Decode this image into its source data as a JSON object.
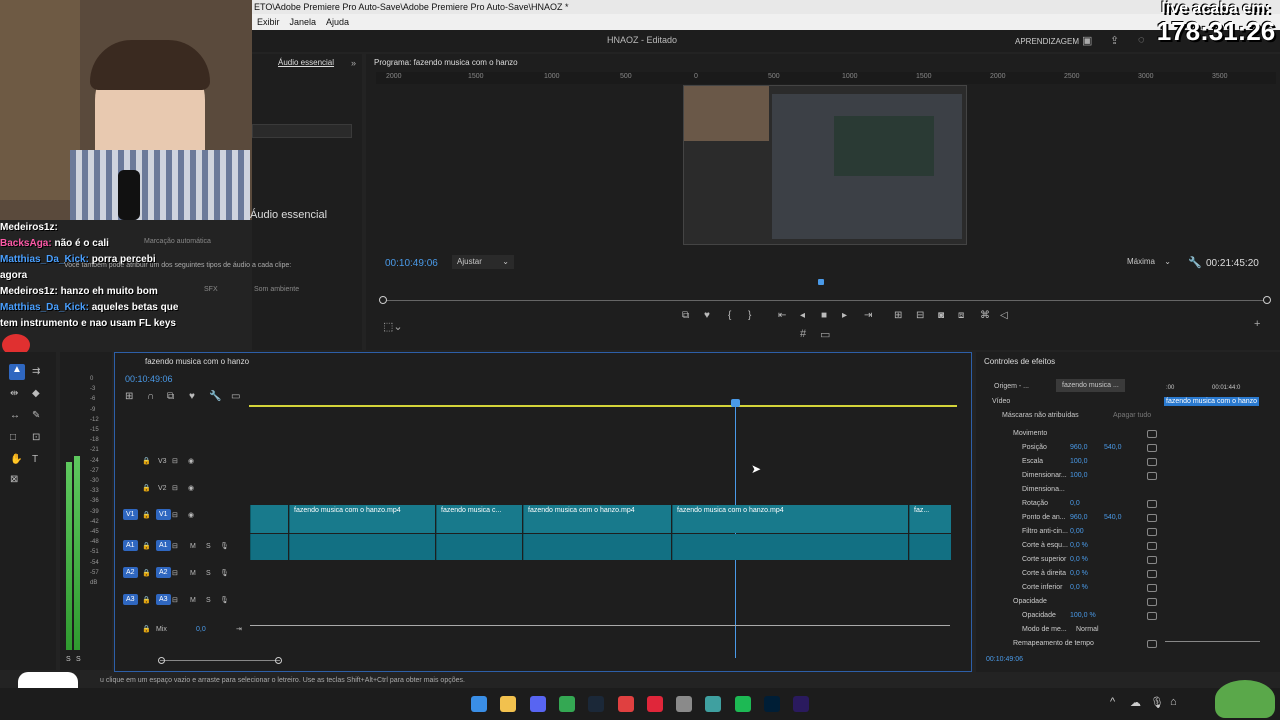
{
  "window": {
    "path": "ETO\\Adobe Premiere Pro Auto-Save\\Adobe Premiere Pro Auto-Save\\HNAOZ *",
    "title": "HNAOZ - Editado",
    "workspace": "APRENDIZAGEM"
  },
  "menu": [
    "Exibir",
    "Janela",
    "Ajuda"
  ],
  "overlay": {
    "live_line1": "live acaba em:",
    "live_timer": "178:31:26"
  },
  "chat": [
    {
      "user": "Medeiros1z:",
      "msg": "",
      "color": "#ffffff"
    },
    {
      "user": "BacksAga:",
      "msg": "não é o cali",
      "color": "#ff5aa8"
    },
    {
      "user": "Matthias_Da_Kick:",
      "msg": "porra percebi",
      "color": "#4aa0ff"
    },
    {
      "user": "agora",
      "msg": "",
      "color": "#ffffff"
    },
    {
      "user": "Medeiros1z:",
      "msg": "hanzo eh muito bom",
      "color": "#ffffff"
    },
    {
      "user": "Matthias_Da_Kick:",
      "msg": "aqueles betas que",
      "color": "#4aa0ff"
    },
    {
      "user": "tem instrumento e nao usam FL keys",
      "msg": "",
      "color": "#ffffff"
    }
  ],
  "essential_audio": {
    "tab": "Áudio essencial",
    "heading": "Áudio essencial",
    "auto": "Marcação automática",
    "hint": "Você também pode atribuir um dos seguintes tipos de áudio a cada clipe:",
    "sfx": "SFX",
    "ambience": "Som ambiente"
  },
  "program": {
    "title": "Programa: fazendo musica com o hanzo",
    "timecode": "00:10:49:06",
    "fit": "Ajustar",
    "quality": "Máxima",
    "duration": "00:21:45:20",
    "ruler": [
      "2000",
      "1500",
      "1000",
      "500",
      "0",
      "500",
      "1000",
      "1500",
      "2000",
      "2500",
      "3000",
      "3500"
    ]
  },
  "timeline": {
    "title": "fazendo musica com o hanzo",
    "timecode": "00:10:49:06",
    "tracks": [
      {
        "name": "V3"
      },
      {
        "name": "V2"
      },
      {
        "name": "V1",
        "src": "V1"
      },
      {
        "name": "A1",
        "src": "A1",
        "m": "M",
        "s": "S"
      },
      {
        "name": "A2",
        "m": "M",
        "s": "S"
      },
      {
        "name": "A3",
        "m": "M",
        "s": "S"
      }
    ],
    "mix_label": "Mix",
    "mix_value": "0,0",
    "clips": [
      "fazendo musica com o hanzo.mp4",
      "fazendo musica c...",
      "fazendo musica com o hanzo.mp4",
      "fazendo musica com o hanzo.mp4",
      "faz..."
    ],
    "meter_scale": [
      "0",
      "-3",
      "-6",
      "-9",
      "-12",
      "-15",
      "-18",
      "-21",
      "-24",
      "-27",
      "-30",
      "-33",
      "-36",
      "-39",
      "-42",
      "-45",
      "-48",
      "-51",
      "-54",
      "-57",
      "dB"
    ],
    "meter_footer": [
      "S",
      "S"
    ]
  },
  "effects": {
    "title": "Controles de efeitos",
    "tab_source": "Origem - ...",
    "tab_seq": "fazendo musica ...",
    "mini_time_start": ":00",
    "mini_time_end": "00:01:44:0",
    "clip_label": "fazendo musica com o hanzo",
    "video": "Vídeo",
    "masks": "Máscaras não atribuídas",
    "apply": "Apagar tudo",
    "rows": [
      {
        "label": "Movimento",
        "v1": "",
        "v2": ""
      },
      {
        "label": "Posição",
        "v1": "960,0",
        "v2": "540,0"
      },
      {
        "label": "Escala",
        "v1": "100,0",
        "v2": ""
      },
      {
        "label": "Dimensionar...",
        "v1": "100,0",
        "v2": ""
      },
      {
        "label": "Dimensiona...",
        "v1": "",
        "v2": ""
      },
      {
        "label": "Rotação",
        "v1": "0,0",
        "v2": ""
      },
      {
        "label": "Ponto de an...",
        "v1": "960,0",
        "v2": "540,0"
      },
      {
        "label": "Filtro anti-cin...",
        "v1": "0,00",
        "v2": ""
      },
      {
        "label": "Corte à esqu...",
        "v1": "0,0 %",
        "v2": ""
      },
      {
        "label": "Corte superior",
        "v1": "0,0 %",
        "v2": ""
      },
      {
        "label": "Corte à direita",
        "v1": "0,0 %",
        "v2": ""
      },
      {
        "label": "Corte inferior",
        "v1": "0,0 %",
        "v2": ""
      },
      {
        "label": "Opacidade",
        "v1": "",
        "v2": ""
      },
      {
        "label": "Opacidade",
        "v1": "100,0 %",
        "v2": ""
      },
      {
        "label": "Modo de me...",
        "v1": "Normal",
        "v2": ""
      },
      {
        "label": "Remapeamento de tempo",
        "v1": "",
        "v2": ""
      }
    ],
    "timecode": "00:10:49:06"
  },
  "status": "u clique em um espaço vazio e arraste para selecionar o letreiro. Use as teclas Shift+Alt+Ctrl para obter mais opções.",
  "taskbar": {
    "apps": [
      "windows-icon",
      "folder-icon",
      "discord-icon",
      "chrome-icon",
      "steam-icon",
      "app-icon",
      "opera-icon",
      "settings-icon",
      "app2-icon",
      "spotify-icon",
      "photoshop-icon",
      "premiere-icon"
    ],
    "colors": [
      "#3a8ee6",
      "#f2c14e",
      "#5865f2",
      "#34a853",
      "#1b2838",
      "#e04040",
      "#e0263a",
      "#8a8a8a",
      "#3fa0a0",
      "#1db954",
      "#001e36",
      "#2a1a5e"
    ]
  }
}
